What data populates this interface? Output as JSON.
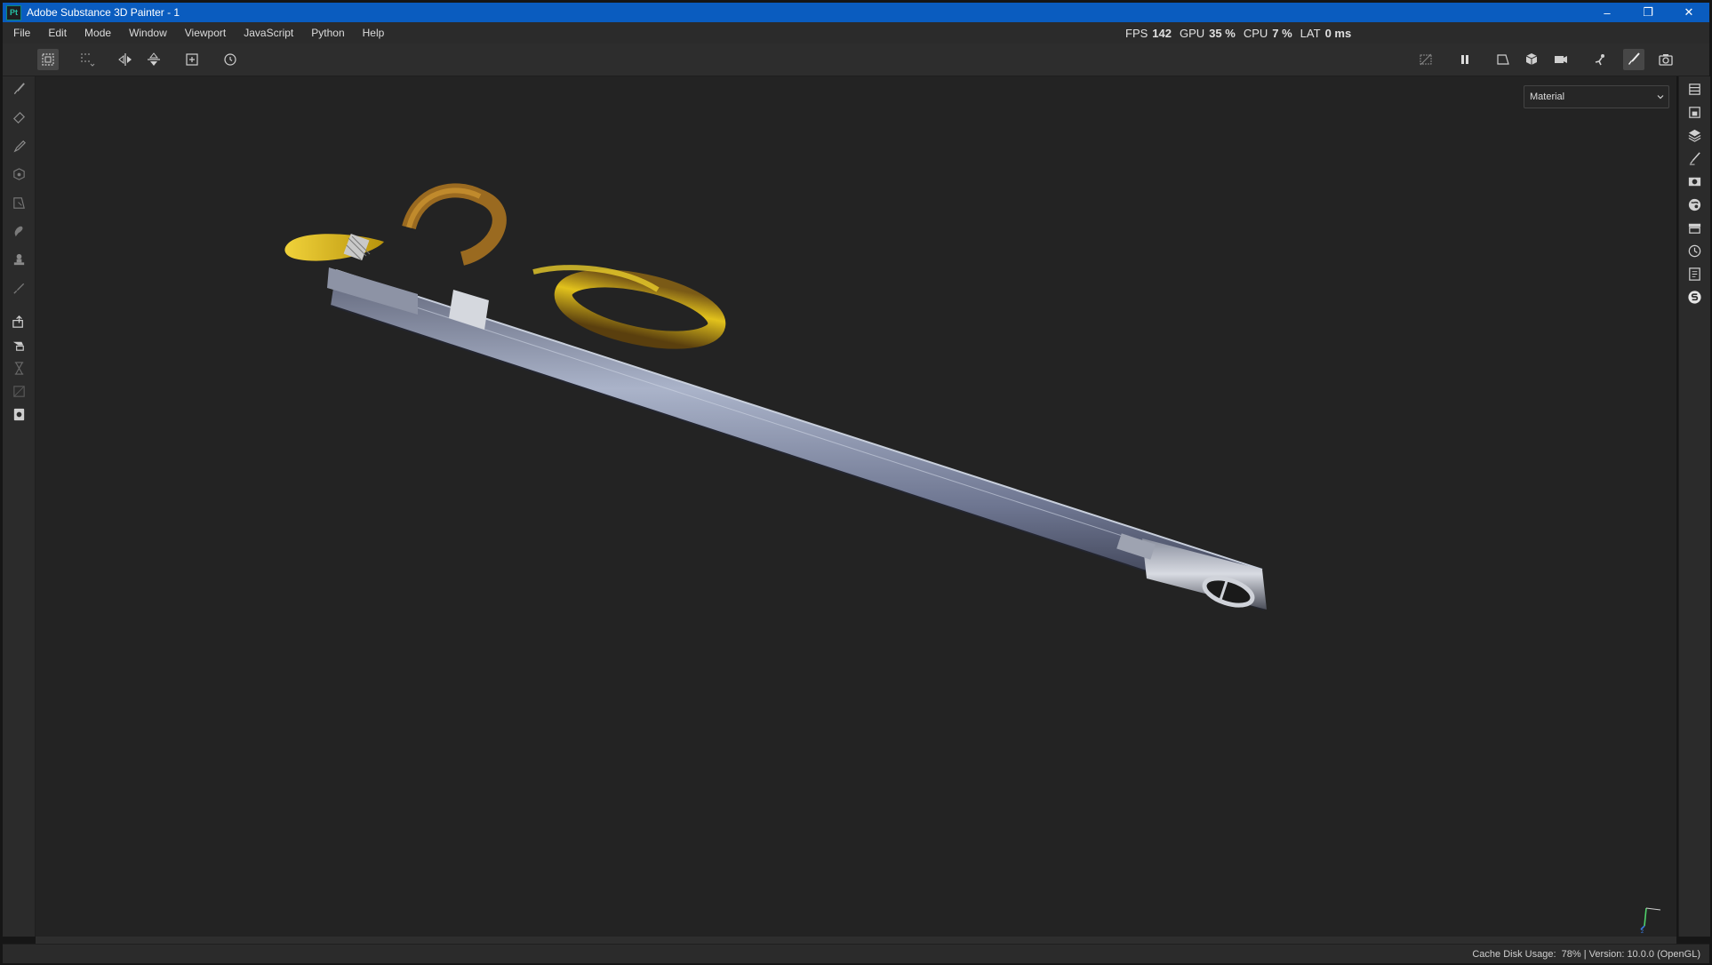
{
  "window": {
    "title": "Adobe Substance 3D Painter - 1",
    "app_badge": "Pt",
    "controls": [
      "minimize-icon",
      "restore-icon",
      "close-icon"
    ]
  },
  "menu": [
    "File",
    "Edit",
    "Mode",
    "Window",
    "Viewport",
    "JavaScript",
    "Python",
    "Help"
  ],
  "stats": {
    "fps_label": "FPS",
    "fps_value": "142",
    "gpu_label": "GPU",
    "gpu_value": "35 %",
    "cpu_label": "CPU",
    "cpu_value": "7 %",
    "lat_label": "LAT",
    "lat_value": "0 ms"
  },
  "toolbar": {
    "left_icons": [
      "selection-mode-icon",
      "grid-icon",
      "symmetry-x-icon",
      "symmetry-y-icon",
      "fit-to-screen-icon",
      "reset-camera-icon"
    ],
    "right_icons": [
      "hide-overlay-icon",
      "pause-icon",
      "projection-icon",
      "view-cube-icon",
      "camera-icon",
      "animation-icon",
      "paint-brush-icon",
      "screenshot-icon"
    ]
  },
  "left_tools": [
    "paint-brush-icon",
    "eraser-icon",
    "projection-icon",
    "geometry-mask-icon",
    "polygon-fill-icon",
    "smudge-icon",
    "clone-icon",
    "color-picker-icon",
    "export-icon",
    "bake-icon",
    "hourglass-icon",
    "uv-unwrap-icon",
    "document-icon"
  ],
  "right_panels": [
    "layers-list-icon",
    "texture-set-icon",
    "layers-icon",
    "properties-icon",
    "display-settings-icon",
    "shader-icon",
    "assets-icon",
    "history-icon",
    "log-icon",
    "substance-icon"
  ],
  "viewport": {
    "channel_dropdown": "Material",
    "accent_gold": "#d4b21a",
    "accent_steel": "#8a94ad"
  },
  "status": {
    "cache_label": "Cache Disk Usage:",
    "cache_value": "78%",
    "separator": "|",
    "version": "Version: 10.0.0 (OpenGL)"
  }
}
